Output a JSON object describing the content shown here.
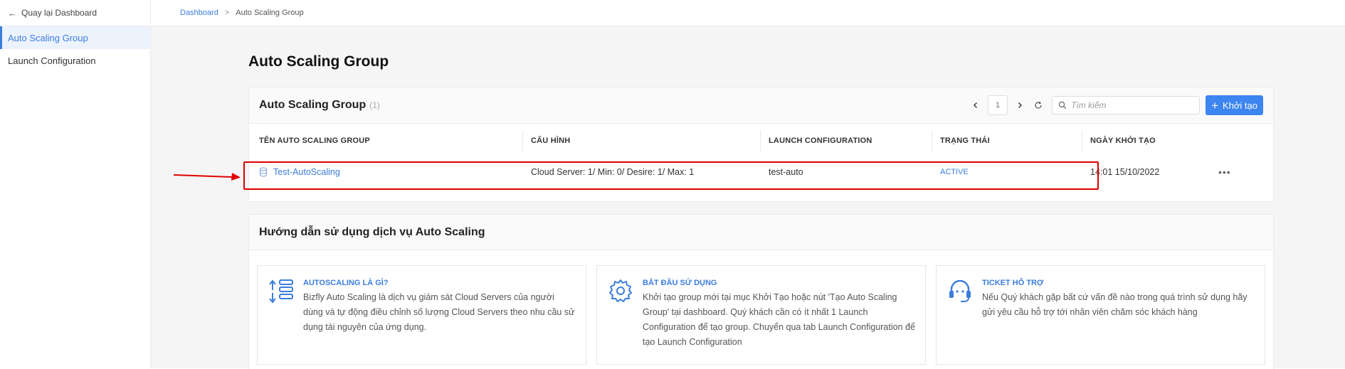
{
  "sidebar": {
    "back_label": "Quay lại Dashboard",
    "items": [
      {
        "label": "Auto Scaling Group",
        "active": true
      },
      {
        "label": "Launch Configuration",
        "active": false
      }
    ]
  },
  "breadcrumb": {
    "root": "Dashboard",
    "separator": ">",
    "current": "Auto Scaling Group"
  },
  "page": {
    "title": "Auto Scaling Group"
  },
  "list": {
    "title": "Auto Scaling Group",
    "count": "(1)",
    "page_number": "1",
    "search_placeholder": "Tìm kiếm",
    "create_label": "Khởi tạo",
    "columns": [
      "TÊN AUTO SCALING GROUP",
      "CẤU HÌNH",
      "LAUNCH CONFIGURATION",
      "TRẠNG THÁI",
      "NGÀY KHỞI TẠO"
    ],
    "rows": [
      {
        "name": "Test-AutoScaling",
        "config": "Cloud Server: 1/ Min: 0/ Desire: 1/ Max: 1",
        "launch_config": "test-auto",
        "status": "ACTIVE",
        "created": "14:01 15/10/2022",
        "more": "•••"
      }
    ]
  },
  "guide": {
    "title": "Hướng dẫn sử dụng dịch vụ Auto Scaling",
    "tiles": [
      {
        "icon": "scaling-icon",
        "title": "AUTOSCALING LÀ GÌ?",
        "text": "Bizfly Auto Scaling là dịch vụ giám sát Cloud Servers của người dùng và tự động điều chỉnh số lượng Cloud Servers theo nhu cầu sử dụng tài nguyên của ứng dụng."
      },
      {
        "icon": "gear-icon",
        "title": "BẮT ĐẦU SỬ DỤNG",
        "text": "Khởi tạo group mới tại mục Khởi Tạo hoặc nút 'Tạo Auto Scaling Group' tại dashboard. Quý khách cần có ít nhất 1 Launch Configuration để tạo group. Chuyển qua tab Launch Configuration để tạo Launch Configuration"
      },
      {
        "icon": "headset-icon",
        "title": "TICKET HỖ TRỢ",
        "text": "Nếu Quý khách gặp bất cứ vấn đề nào trong quá trình sử dụng hãy gửi yêu cầu hỗ trợ tới nhân viên chăm sóc khách hàng"
      }
    ]
  },
  "colors": {
    "accent": "#3b7ddd",
    "button": "#3d85f0",
    "highlight": "#e00000"
  }
}
